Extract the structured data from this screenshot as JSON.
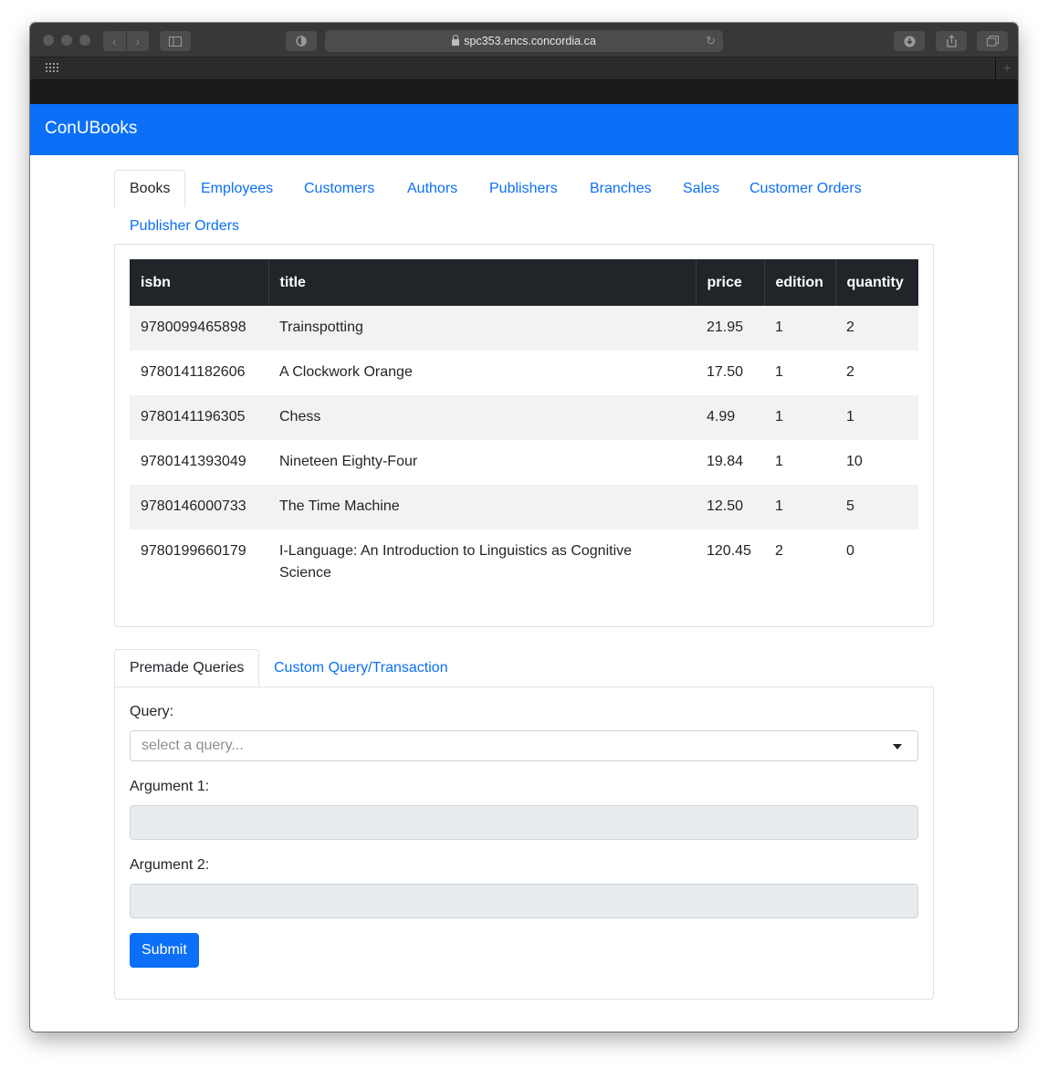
{
  "browser": {
    "url": "spc353.encs.concordia.ca"
  },
  "app": {
    "brand": "ConUBooks"
  },
  "tabs": [
    {
      "label": "Books",
      "active": true
    },
    {
      "label": "Employees",
      "active": false
    },
    {
      "label": "Customers",
      "active": false
    },
    {
      "label": "Authors",
      "active": false
    },
    {
      "label": "Publishers",
      "active": false
    },
    {
      "label": "Branches",
      "active": false
    },
    {
      "label": "Sales",
      "active": false
    },
    {
      "label": "Customer Orders",
      "active": false
    },
    {
      "label": "Publisher Orders",
      "active": false
    }
  ],
  "table": {
    "columns": [
      "isbn",
      "title",
      "price",
      "edition",
      "quantity"
    ],
    "rows": [
      [
        "9780099465898",
        "Trainspotting",
        "21.95",
        "1",
        "2"
      ],
      [
        "9780141182606",
        "A Clockwork Orange",
        "17.50",
        "1",
        "2"
      ],
      [
        "9780141196305",
        "Chess",
        "4.99",
        "1",
        "1"
      ],
      [
        "9780141393049",
        "Nineteen Eighty-Four",
        "19.84",
        "1",
        "10"
      ],
      [
        "9780146000733",
        "The Time Machine",
        "12.50",
        "1",
        "5"
      ],
      [
        "9780199660179",
        "I-Language: An Introduction to Linguistics as Cognitive Science",
        "120.45",
        "2",
        "0"
      ]
    ]
  },
  "query_tabs": [
    {
      "label": "Premade Queries",
      "active": true
    },
    {
      "label": "Custom Query/Transaction",
      "active": false
    }
  ],
  "query_form": {
    "query_label": "Query:",
    "query_placeholder": "select a query...",
    "arg1_label": "Argument 1:",
    "arg2_label": "Argument 2:",
    "submit_label": "Submit"
  },
  "colors": {
    "primary": "#0b6ff7",
    "table_header": "#212529",
    "stripe": "#f2f2f2"
  }
}
